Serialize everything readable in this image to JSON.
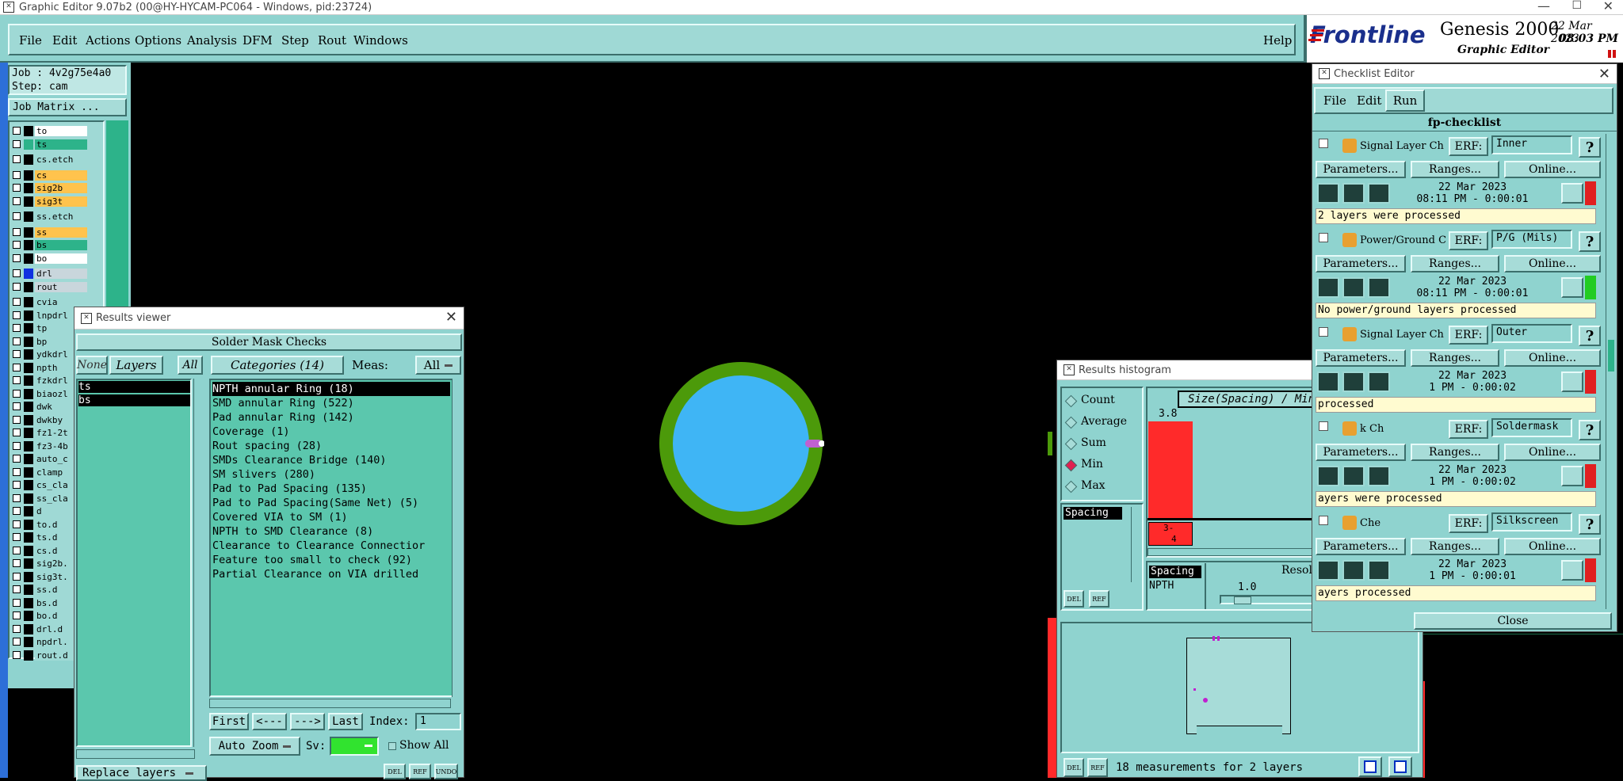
{
  "window": {
    "title": "Graphic Editor 9.07b2 (00@HY-HYCAM-PC064 - Windows, pid:23724)"
  },
  "menu": {
    "items": [
      "File",
      "Edit",
      "Actions",
      "Options",
      "Analysis",
      "DFM",
      "Step",
      "Rout",
      "Windows"
    ],
    "help": "Help"
  },
  "brand": {
    "logo": "Frontline",
    "product": "Genesis 2000",
    "subtitle": "Graphic Editor",
    "date": "22 Mar 2023",
    "time": "08:03 PM"
  },
  "job": {
    "job_label": "Job : 4v2g75e4a0",
    "step_label": "Step: cam",
    "matrix_button": "Job Matrix ..."
  },
  "layers": [
    {
      "name": "to",
      "color": "#ffffff"
    },
    {
      "name": "ts",
      "color": "#2db38a"
    },
    {
      "name": "cs.etch",
      "color": "#9fd9d5"
    },
    {
      "name": "cs",
      "color": "#ffc34d"
    },
    {
      "name": "sig2b",
      "color": "#ffc34d"
    },
    {
      "name": "sig3t",
      "color": "#ffc34d"
    },
    {
      "name": "ss.etch",
      "color": "#9fd9d5"
    },
    {
      "name": "ss",
      "color": "#ffc34d"
    },
    {
      "name": "bs",
      "color": "#2db38a"
    },
    {
      "name": "bo",
      "color": "#ffffff"
    },
    {
      "name": "drl",
      "color": "#c9d6dc"
    },
    {
      "name": "rout",
      "color": "#c9d6dc"
    },
    {
      "name": "cvia",
      "color": "#9fd9d5"
    },
    {
      "name": "lnpdrl",
      "color": "#9fd9d5"
    },
    {
      "name": "tp",
      "color": "#9fd9d5"
    },
    {
      "name": "bp",
      "color": "#9fd9d5"
    },
    {
      "name": "ydkdrl",
      "color": "#9fd9d5"
    },
    {
      "name": "npth",
      "color": "#9fd9d5"
    },
    {
      "name": "fzkdrl",
      "color": "#9fd9d5"
    },
    {
      "name": "biaozl",
      "color": "#9fd9d5"
    },
    {
      "name": "dwk",
      "color": "#9fd9d5"
    },
    {
      "name": "dwkby",
      "color": "#9fd9d5"
    },
    {
      "name": "fz1-2t",
      "color": "#9fd9d5"
    },
    {
      "name": "fz3-4b",
      "color": "#9fd9d5"
    },
    {
      "name": "auto_c",
      "color": "#9fd9d5"
    },
    {
      "name": "clamp",
      "color": "#9fd9d5"
    },
    {
      "name": "cs_cla",
      "color": "#9fd9d5"
    },
    {
      "name": "ss_cla",
      "color": "#9fd9d5"
    },
    {
      "name": "d",
      "color": "#9fd9d5"
    },
    {
      "name": "to.d",
      "color": "#9fd9d5"
    },
    {
      "name": "ts.d",
      "color": "#9fd9d5"
    },
    {
      "name": "cs.d",
      "color": "#9fd9d5"
    },
    {
      "name": "sig2b.",
      "color": "#9fd9d5"
    },
    {
      "name": "sig3t.",
      "color": "#9fd9d5"
    },
    {
      "name": "ss.d",
      "color": "#9fd9d5"
    },
    {
      "name": "bs.d",
      "color": "#9fd9d5"
    },
    {
      "name": "bo.d",
      "color": "#9fd9d5"
    },
    {
      "name": "drl.d",
      "color": "#9fd9d5"
    },
    {
      "name": "npdrl.",
      "color": "#9fd9d5"
    },
    {
      "name": "rout.d",
      "color": "#9fd9d5"
    }
  ],
  "results_viewer": {
    "title": "Results viewer",
    "header": "Solder Mask Checks",
    "none": "None",
    "layers": "Layers",
    "all": "All",
    "categories_btn": "Categories (14)",
    "meas_label": "Meas:",
    "meas_value": "All",
    "layer_list": [
      "ts",
      "bs"
    ],
    "categories": [
      "NPTH annular Ring (18)",
      "SMD annular Ring (522)",
      "Pad annular Ring (142)",
      "Coverage (1)",
      "Rout spacing (28)",
      "SMDs Clearance Bridge (140)",
      "SM slivers (280)",
      "Pad to Pad Spacing (135)",
      "Pad to Pad Spacing(Same Net) (5)",
      "Covered VIA to SM (1)",
      "NPTH to SMD Clearance (8)",
      "Clearance to Clearance Connectior",
      "Feature too small to check (92)",
      "Partial Clearance on VIA drilled"
    ],
    "first": "First",
    "prev": "<---",
    "next": "--->",
    "last": "Last",
    "index_label": "Index:",
    "index_value": "1",
    "auto_zoom": "Auto Zoom",
    "sv_label": "Sv:",
    "show_all": "Show All",
    "replace_layers": "Replace layers",
    "del": "DEL",
    "ref": "REF",
    "undo": "UNDO"
  },
  "histogram": {
    "title": "Results histogram",
    "options": [
      "Count",
      "Average",
      "Sum",
      "Min",
      "Max"
    ],
    "selected_option": "Min",
    "chart_title": "Size(Spacing) / Min(Spacing)",
    "bar_value": "3.8",
    "bin_label_top": "3-",
    "bin_label_bottom": "4",
    "list_selected": "Spacing",
    "legend_a": "Spacing",
    "legend_b": "NPTH",
    "resolution_label": "Resolution",
    "resolution_value": "1.0",
    "status": "18 measurements for 2 layers",
    "del": "DEL",
    "ref": "REF"
  },
  "checklist": {
    "title": "Checklist Editor",
    "menu": [
      "File",
      "Edit",
      "Run"
    ],
    "name": "fp-checklist",
    "erf_label": "ERF:",
    "params": "Parameters...",
    "ranges": "Ranges...",
    "online": "Online...",
    "checks": [
      {
        "title": "Signal Layer Ch",
        "erf": "Inner",
        "date": "22 Mar 2023",
        "time": "08:11 PM - 0:00:01",
        "status": "2 layers were processed",
        "indicator": "#e02020"
      },
      {
        "title": "Power/Ground C",
        "erf": "P/G (Mils)",
        "date": "22 Mar 2023",
        "time": "08:11 PM - 0:00:01",
        "status": "No power/ground layers processed",
        "indicator": "#22cc22"
      },
      {
        "title": "Signal Layer Ch",
        "erf": "Outer",
        "date": "22 Mar 2023",
        "time": "1 PM - 0:00:02",
        "status": "processed",
        "indicator": "#e02020"
      },
      {
        "title": "k Ch",
        "erf": "Soldermask",
        "date": "22 Mar 2023",
        "time": "1 PM - 0:00:02",
        "status": "ayers were processed",
        "indicator": "#e02020"
      },
      {
        "title": "Che",
        "erf": "Silkscreen",
        "date": "22 Mar 2023",
        "time": "1 PM - 0:00:01",
        "status": "ayers processed",
        "indicator": "#e02020"
      }
    ],
    "close": "Close",
    "help": "?"
  },
  "colors": {
    "canvas": "#000000",
    "pad_ring": "#4c9a0a",
    "pad_fill": "#3fb5f5",
    "app_teal": "#8fd3cf",
    "bar_red": "#ff2a2a"
  }
}
